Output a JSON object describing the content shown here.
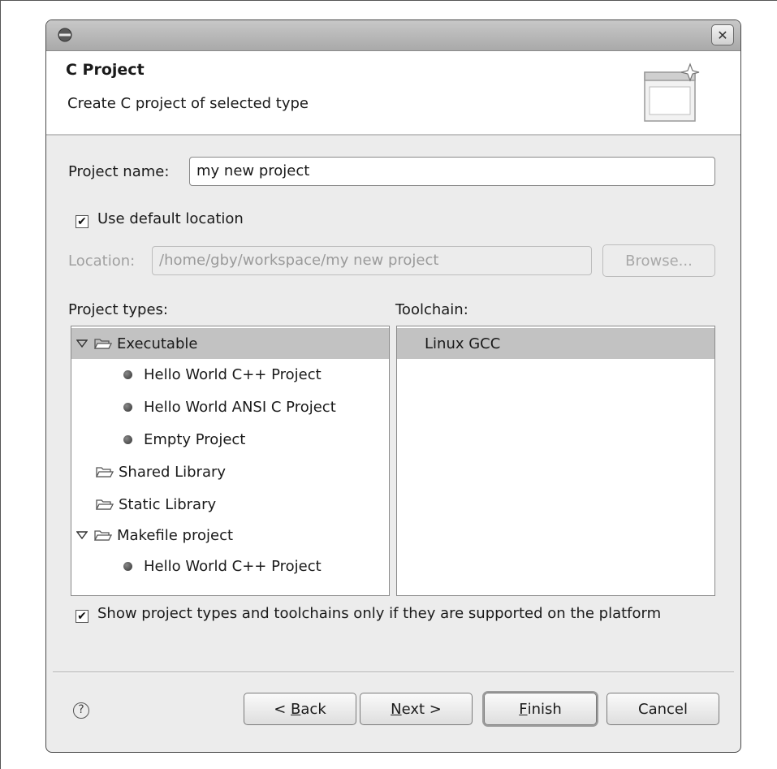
{
  "window": {
    "title": "",
    "close_glyph": "✕"
  },
  "banner": {
    "title": "C Project",
    "subtitle": "Create C project of selected type",
    "icon": "new-project-wizard-icon"
  },
  "project_name": {
    "label": "Project name:",
    "value": "my new project"
  },
  "use_default_location": {
    "label": "Use default location",
    "checked": true
  },
  "location": {
    "label": "Location:",
    "value": "/home/gby/workspace/my new project",
    "enabled": false,
    "browse_label": "Browse..."
  },
  "project_types": {
    "label": "Project types:",
    "items": [
      {
        "label": "Executable",
        "kind": "folder",
        "expanded": true,
        "selected": true,
        "level": 0
      },
      {
        "label": "Hello World C++ Project",
        "kind": "leaf",
        "level": 1
      },
      {
        "label": "Hello World ANSI C Project",
        "kind": "leaf",
        "level": 1
      },
      {
        "label": "Empty Project",
        "kind": "leaf",
        "level": 1
      },
      {
        "label": "Shared Library",
        "kind": "folder",
        "expanded": false,
        "level": 0
      },
      {
        "label": "Static Library",
        "kind": "folder",
        "expanded": false,
        "level": 0
      },
      {
        "label": "Makefile project",
        "kind": "folder",
        "expanded": true,
        "level": 0
      },
      {
        "label": "Hello World C++ Project",
        "kind": "leaf",
        "level": 1
      }
    ]
  },
  "toolchain": {
    "label": "Toolchain:",
    "items": [
      {
        "label": "Linux GCC",
        "selected": true
      }
    ]
  },
  "show_supported_only": {
    "label": "Show project types and toolchains only if they are supported on the platform",
    "checked": true
  },
  "buttons": {
    "help_glyph": "?",
    "back": {
      "prefix": "< ",
      "mnemonic": "B",
      "rest": "ack"
    },
    "next": {
      "mnemonic": "N",
      "rest": "ext >"
    },
    "finish": {
      "mnemonic": "F",
      "rest": "inish"
    },
    "cancel": "Cancel"
  },
  "check_glyph": "✔"
}
